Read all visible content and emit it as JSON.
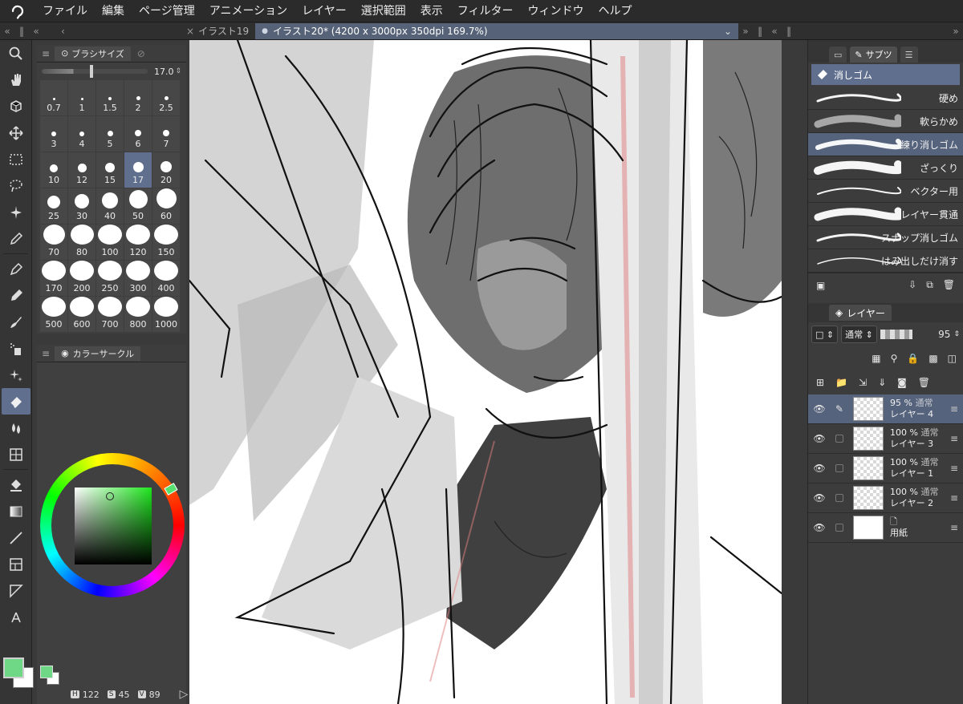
{
  "menu": {
    "items": [
      "ファイル",
      "編集",
      "ページ管理",
      "アニメーション",
      "レイヤー",
      "選択範囲",
      "表示",
      "フィルター",
      "ウィンドウ",
      "ヘルプ"
    ]
  },
  "tabs": {
    "inactive_label": "イラスト19",
    "active_label": "イラスト20* (4200 x 3000px 350dpi 169.7%)"
  },
  "brush_panel": {
    "tab_label": "ブラシサイズ",
    "value": "17.0",
    "sizes": [
      "0.7",
      "1",
      "1.5",
      "2",
      "2.5",
      "3",
      "4",
      "5",
      "6",
      "7",
      "10",
      "12",
      "15",
      "17",
      "20",
      "25",
      "30",
      "40",
      "50",
      "60",
      "70",
      "80",
      "100",
      "120",
      "150",
      "170",
      "200",
      "250",
      "300",
      "400",
      "500",
      "600",
      "700",
      "800",
      "1000"
    ],
    "selected": "17"
  },
  "color_panel": {
    "tab_label": "カラーサークル",
    "main_color": "#6ed887",
    "sub_color": "#ffffff",
    "readout": {
      "h_key": "H",
      "h": "122",
      "s_key": "S",
      "s": "45",
      "v_key": "V",
      "v": "89"
    }
  },
  "subtool": {
    "tab_label": "サブツ",
    "group_title": "消しゴム",
    "items": [
      "硬め",
      "軟らかめ",
      "練り消しゴム",
      "ざっくり",
      "ベクター用",
      "レイヤー貫通",
      "スナップ消しゴム",
      "はみ出しだけ消す"
    ],
    "selected": "練り消しゴム"
  },
  "layers": {
    "tab_label": "レイヤー",
    "blend_mode": "通常",
    "opacity": "95",
    "rows": [
      {
        "percent": "95 %",
        "mode": "通常",
        "name": "レイヤー 4",
        "active": true
      },
      {
        "percent": "100 %",
        "mode": "通常",
        "name": "レイヤー 3",
        "active": false
      },
      {
        "percent": "100 %",
        "mode": "通常",
        "name": "レイヤー 1",
        "active": false
      },
      {
        "percent": "100 %",
        "mode": "通常",
        "name": "レイヤー 2",
        "active": false
      },
      {
        "percent": "",
        "mode": "",
        "name": "用紙",
        "active": false
      }
    ]
  },
  "icons": {
    "tools": [
      "zoom-icon",
      "hand-icon",
      "object-icon",
      "move-icon",
      "marquee-icon",
      "lasso-icon",
      "auto-select-icon",
      "eyedropper-icon",
      "pen-icon",
      "pencil-icon",
      "brush-icon",
      "airbrush-icon",
      "decoration-icon",
      "eraser-icon",
      "blend-icon",
      "figure-icon",
      "fill-icon",
      "gradient-icon",
      "line-icon",
      "frame-icon",
      "ruler-icon",
      "text-icon"
    ]
  }
}
